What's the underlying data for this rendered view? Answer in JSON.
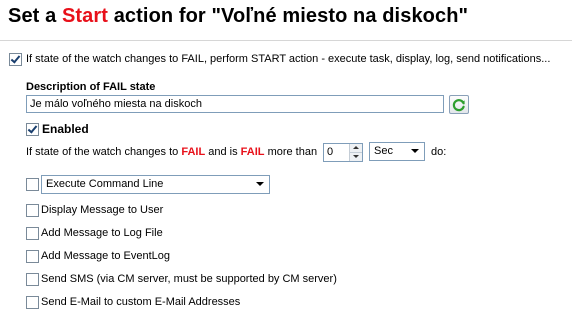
{
  "header": {
    "title_prefix": "Set a ",
    "title_highlight": "Start",
    "title_suffix": " action for \"Voľné miesto na diskoch\""
  },
  "main_option": {
    "checked": true,
    "label": "If state of the watch changes to FAIL, perform START action - execute task, display, log, send notifications..."
  },
  "description": {
    "label": "Description of FAIL state",
    "value": "Je málo voľného miesta na diskoch"
  },
  "enabled": {
    "checked": true,
    "label": "Enabled"
  },
  "condition": {
    "part1": "If state of the watch changes to",
    "fail1": "FAIL",
    "part2": "and is",
    "fail2": "FAIL",
    "part3": "more than",
    "duration_value": "0",
    "unit": "Sec",
    "part4": "do:"
  },
  "actions": {
    "command_line": {
      "checked": false,
      "label": "Execute Command Line"
    },
    "display_message": {
      "checked": false,
      "label": "Display Message to User"
    },
    "log_file": {
      "checked": false,
      "label": "Add Message to Log File"
    },
    "event_log": {
      "checked": false,
      "label": "Add Message to EventLog"
    },
    "sms": {
      "checked": false,
      "label": "Send SMS (via CM server, must be supported by CM server)"
    },
    "email": {
      "checked": false,
      "label": "Send E-Mail to custom E-Mail Addresses"
    }
  },
  "colors": {
    "accent_red": "#e8101a",
    "check_green": "#21a121"
  }
}
